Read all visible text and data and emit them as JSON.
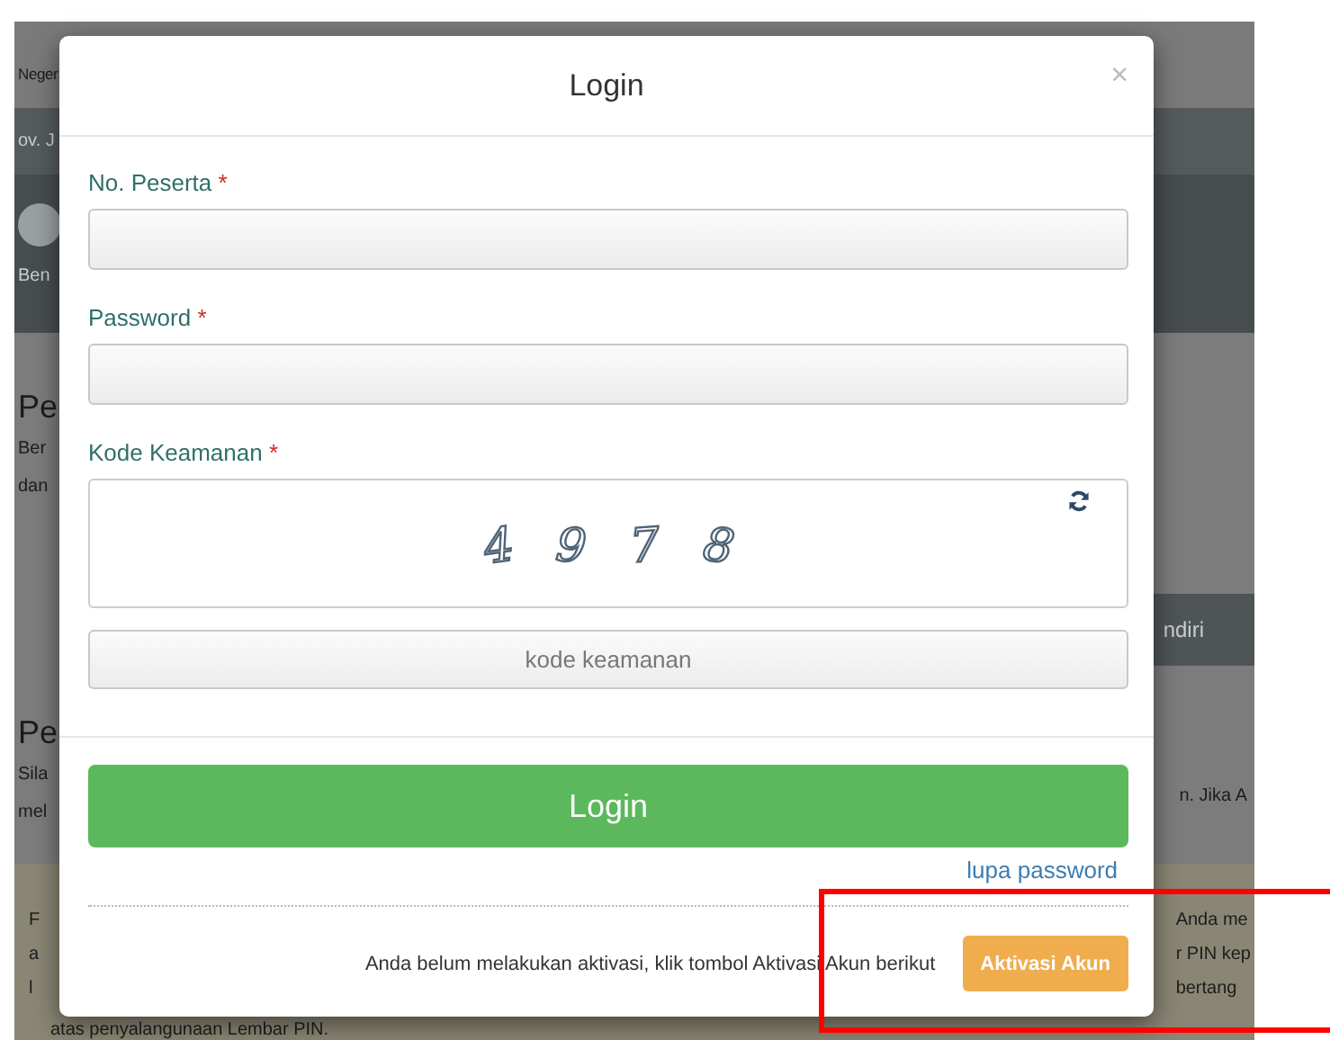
{
  "background": {
    "top_link": "Neger",
    "nav_text": "ov. J",
    "nav_item": "Ben",
    "section1_title": "Pe",
    "section1_lines": [
      "Ber",
      "dan"
    ],
    "tab_text": "ndiri",
    "section2_title": "Pe",
    "section2_lines": [
      "Sila",
      "mel"
    ],
    "section2_right": "n. Jika A",
    "notice_left": [
      "F",
      "a",
      "l"
    ],
    "notice_right": [
      "Anda me",
      "r PIN kep",
      "bertang"
    ],
    "notice_last": "atas penyalangunaan Lembar PIN."
  },
  "modal": {
    "title": "Login",
    "close": "×",
    "fields": [
      {
        "label": "No. Peserta",
        "required": "*"
      },
      {
        "label": "Password",
        "required": "*"
      }
    ],
    "captcha": {
      "label": "Kode Keamanan",
      "required": "*",
      "digits": [
        "4",
        "9",
        "7",
        "8"
      ]
    },
    "captcha_input": {
      "placeholder": "kode keamanan"
    },
    "login_button": "Login",
    "forgot_link": "lupa password",
    "activation_text": "Anda belum melakukan aktivasi, klik tombol Aktivasi Akun berikut",
    "activation_button": "Aktivasi Akun"
  }
}
